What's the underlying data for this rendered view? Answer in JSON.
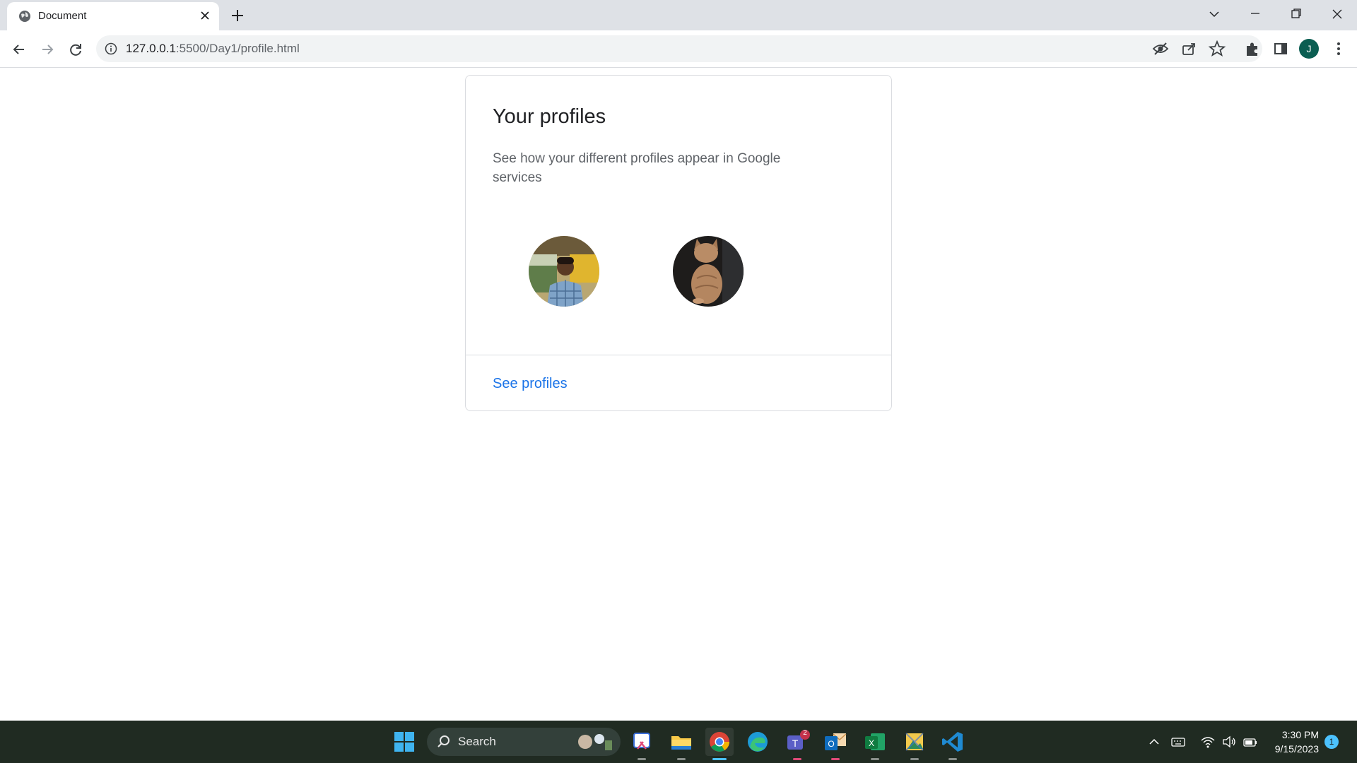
{
  "browser": {
    "tab_title": "Document",
    "url_host": "127.0.0.1",
    "url_rest": ":5500/Day1/profile.html",
    "profile_initial": "J"
  },
  "page": {
    "title": "Your profiles",
    "description": "See how your different profiles appear in Google services",
    "link_label": "See profiles",
    "link_color": "#1a73e8",
    "profiles": [
      {
        "icon": "person-photo"
      },
      {
        "icon": "cat-photo"
      }
    ]
  },
  "taskbar": {
    "search_label": "Search",
    "time": "3:30 PM",
    "date": "9/15/2023",
    "notification_count": "1",
    "teams_badge": "2",
    "apps": [
      "windows-start-icon",
      "snipping-tool-icon",
      "file-explorer-icon",
      "chrome-icon",
      "edge-icon",
      "teams-icon",
      "outlook-icon",
      "excel-icon",
      "image-viewer-icon",
      "vscode-icon"
    ]
  }
}
